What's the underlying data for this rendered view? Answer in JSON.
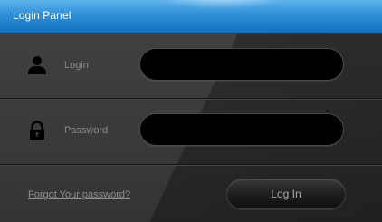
{
  "header": {
    "title": "Login Panel"
  },
  "login_field": {
    "label": "Login",
    "value": "",
    "icon": "user-icon"
  },
  "password_field": {
    "label": "Password",
    "value": "",
    "icon": "lock-icon"
  },
  "actions": {
    "forgot_password_label": "Forgot Your password?",
    "login_button_label": "Log In"
  },
  "colors": {
    "header_accent": "#2f8fd6",
    "panel_background": "#2b2b2b",
    "input_background": "#000000",
    "label_text": "#8a8a8a"
  }
}
